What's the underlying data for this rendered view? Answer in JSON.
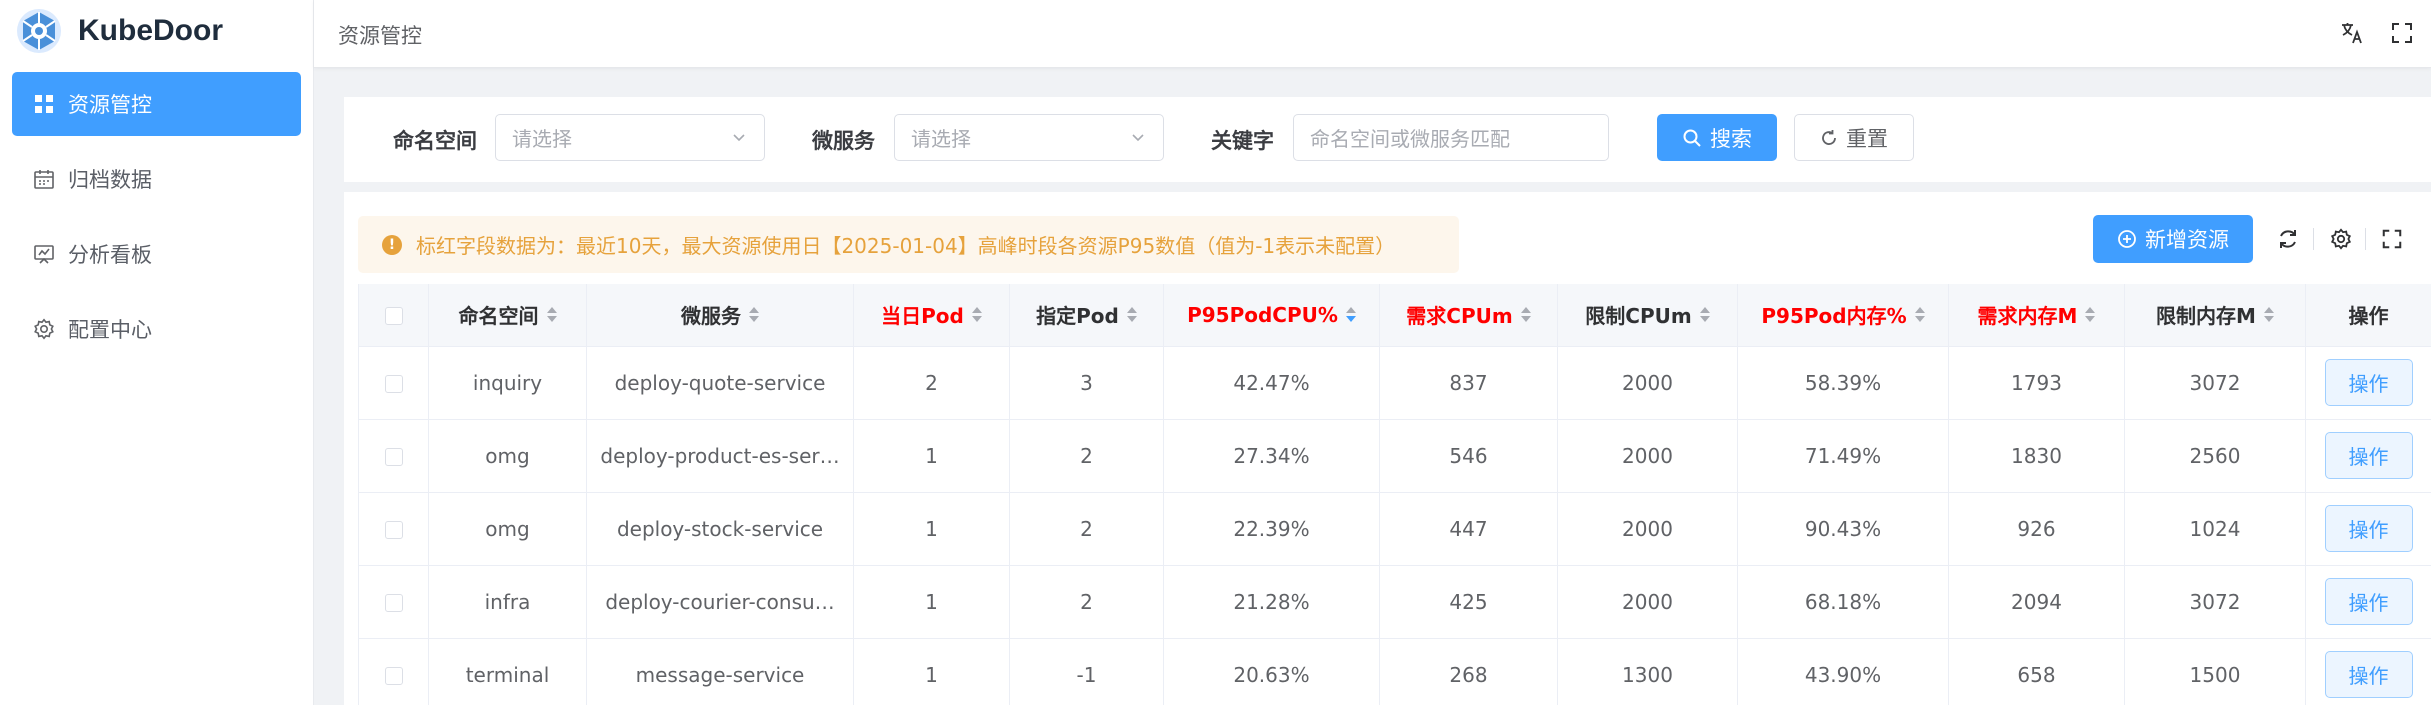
{
  "brand": {
    "name": "KubeDoor"
  },
  "sidebar": {
    "items": [
      {
        "label": "资源管控",
        "icon": "grid-icon",
        "active": true
      },
      {
        "label": "归档数据",
        "icon": "calendar-icon",
        "active": false
      },
      {
        "label": "分析看板",
        "icon": "board-icon",
        "active": false
      },
      {
        "label": "配置中心",
        "icon": "gear-icon",
        "active": false
      }
    ]
  },
  "header": {
    "breadcrumb": "资源管控",
    "icons": [
      "translate-icon",
      "fullscreen-icon"
    ]
  },
  "search": {
    "namespace_label": "命名空间",
    "namespace_placeholder": "请选择",
    "service_label": "微服务",
    "service_placeholder": "请选择",
    "keyword_label": "关键字",
    "keyword_placeholder": "命名空间或微服务匹配",
    "search_button": "搜索",
    "reset_button": "重置"
  },
  "alert": {
    "text": "标红字段数据为：最近10天，最大资源使用日【2025-01-04】高峰时段各资源P95数值（值为-1表示未配置）"
  },
  "toolbar": {
    "add_button": "新增资源"
  },
  "table": {
    "columns": [
      {
        "label": "命名空间",
        "red": false,
        "sort": "none"
      },
      {
        "label": "微服务",
        "red": false,
        "sort": "none"
      },
      {
        "label": "当日Pod",
        "red": true,
        "sort": "none"
      },
      {
        "label": "指定Pod",
        "red": false,
        "sort": "none"
      },
      {
        "label": "P95PodCPU%",
        "red": true,
        "sort": "desc"
      },
      {
        "label": "需求CPUm",
        "red": true,
        "sort": "none"
      },
      {
        "label": "限制CPUm",
        "red": false,
        "sort": "none"
      },
      {
        "label": "P95Pod内存%",
        "red": true,
        "sort": "none"
      },
      {
        "label": "需求内存M",
        "red": true,
        "sort": "none"
      },
      {
        "label": "限制内存M",
        "red": false,
        "sort": "none"
      },
      {
        "label": "操作",
        "red": false,
        "sort": "none"
      }
    ],
    "action_label": "操作",
    "rows": [
      [
        "inquiry",
        "deploy-quote-service",
        "2",
        "3",
        "42.47%",
        "837",
        "2000",
        "58.39%",
        "1793",
        "3072"
      ],
      [
        "omg",
        "deploy-product-es-ser…",
        "1",
        "2",
        "27.34%",
        "546",
        "2000",
        "71.49%",
        "1830",
        "2560"
      ],
      [
        "omg",
        "deploy-stock-service",
        "1",
        "2",
        "22.39%",
        "447",
        "2000",
        "90.43%",
        "926",
        "1024"
      ],
      [
        "infra",
        "deploy-courier-consu…",
        "1",
        "2",
        "21.28%",
        "425",
        "2000",
        "68.18%",
        "2094",
        "3072"
      ],
      [
        "terminal",
        "message-service",
        "1",
        "-1",
        "20.63%",
        "268",
        "1300",
        "43.90%",
        "658",
        "1500"
      ]
    ]
  },
  "colors": {
    "primary": "#409eff",
    "warning": "#e6a23c",
    "warning_bg": "#fdf6ec",
    "red_header": "#ff0000"
  }
}
